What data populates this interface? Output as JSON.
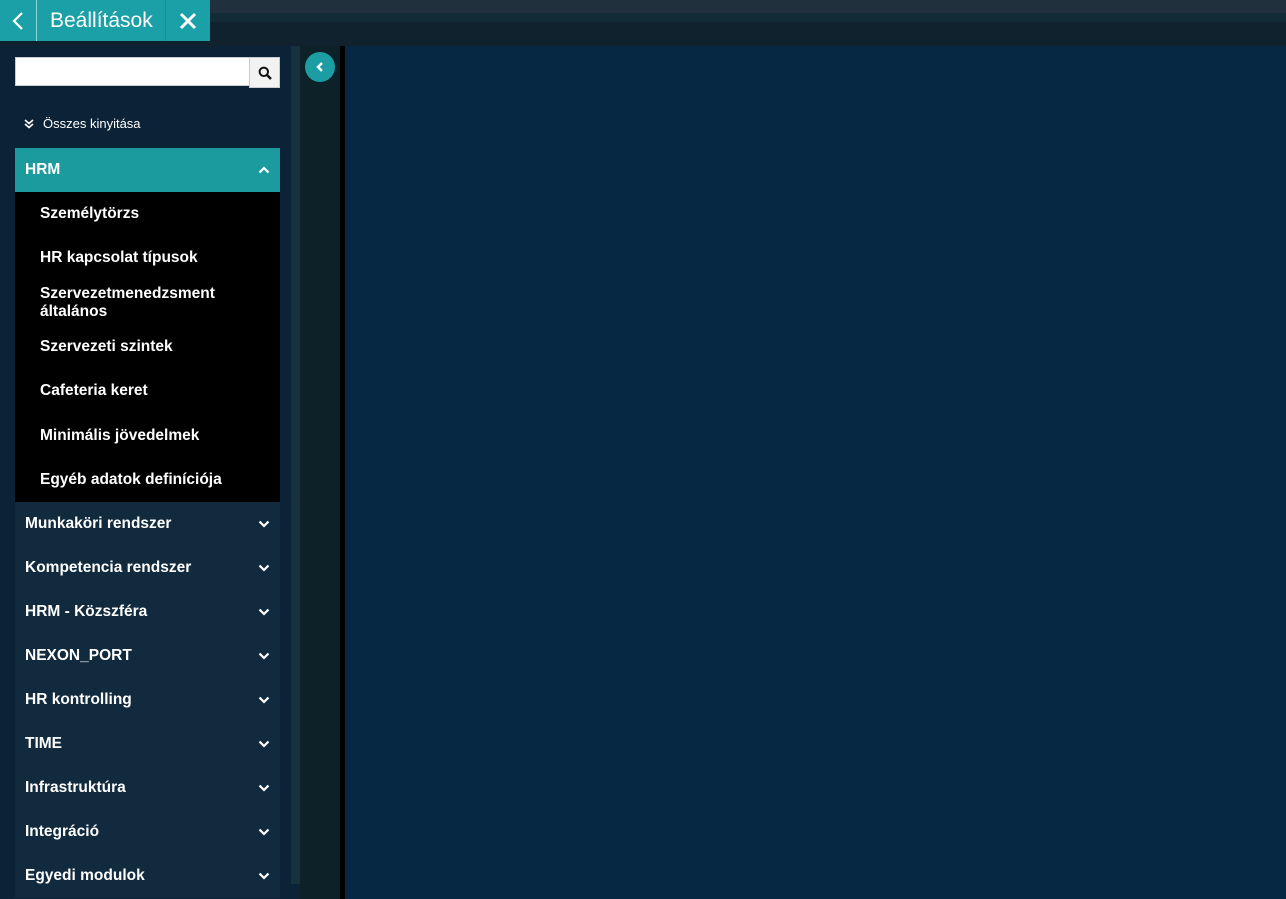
{
  "header": {
    "title": "Beállítások",
    "back_icon": "chevron-left-icon",
    "close_icon": "close-icon",
    "accent_color": "#1aa0a6"
  },
  "sidebar": {
    "search": {
      "value": "",
      "placeholder": "",
      "icon": "search-icon"
    },
    "expand_all_label": "Összes kinyitása",
    "sections": [
      {
        "label": "HRM",
        "expanded": true,
        "items": [
          "Személytörzs",
          "HR kapcsolat típusok",
          "Szervezetmenedzsment általános",
          "Szervezeti szintek",
          "Cafeteria keret",
          "Minimális jövedelmek",
          "Egyéb adatok definíciója"
        ]
      },
      {
        "label": "Munkaköri rendszer",
        "expanded": false
      },
      {
        "label": "Kompetencia rendszer",
        "expanded": false
      },
      {
        "label": "HRM - Közszféra",
        "expanded": false
      },
      {
        "label": "NEXON_PORT",
        "expanded": false
      },
      {
        "label": "HR kontrolling",
        "expanded": false
      },
      {
        "label": "TIME",
        "expanded": false
      },
      {
        "label": "Infrastruktúra",
        "expanded": false
      },
      {
        "label": "Integráció",
        "expanded": false
      },
      {
        "label": "Egyedi modulok",
        "expanded": false
      }
    ]
  },
  "collapse_button_icon": "chevron-left-icon"
}
